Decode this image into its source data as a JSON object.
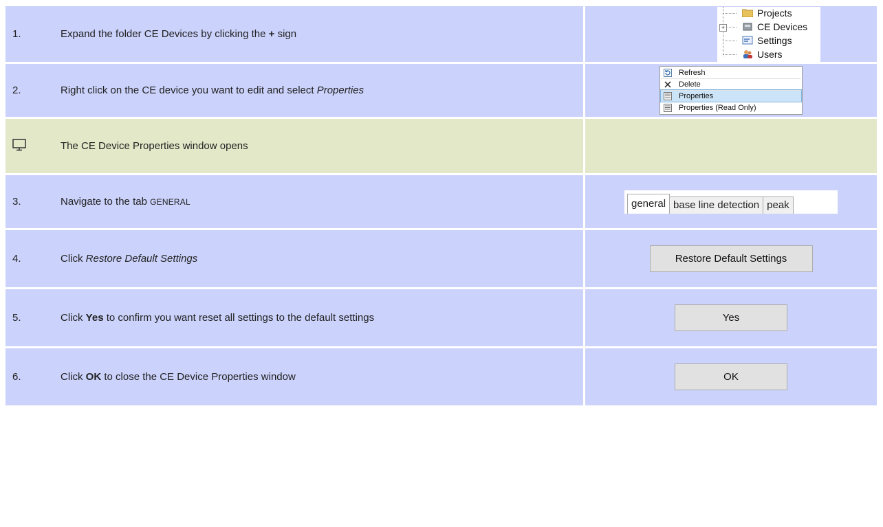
{
  "steps": [
    {
      "num": "1.",
      "pre": "Expand the folder CE Devices by clicking the ",
      "bold": "+",
      "post": " sign"
    },
    {
      "num": "2.",
      "pre": "Right click on the CE device you want to edit and select ",
      "italic": "Properties",
      "post": ""
    },
    {
      "note": "The CE Device Properties window opens"
    },
    {
      "num": "3.",
      "pre": "Navigate to the tab ",
      "smallcaps": "GENERAL",
      "post": ""
    },
    {
      "num": "4.",
      "pre": "Click ",
      "italic": "Restore Default Settings",
      "post": ""
    },
    {
      "num": "5.",
      "pre": "Click ",
      "bold": "Yes",
      "post": " to confirm you want reset all settings to the default settings"
    },
    {
      "num": "6.",
      "pre": "Click ",
      "bold": "OK",
      "post": " to close the CE Device Properties window"
    }
  ],
  "tree": {
    "items": [
      "Projects",
      "CE Devices",
      "Settings",
      "Users"
    ],
    "icons": [
      "folder-icon",
      "ce-device-icon",
      "settings-icon",
      "users-icon"
    ],
    "expander": "+"
  },
  "menu": {
    "items": [
      "Refresh",
      "Delete",
      "Properties",
      "Properties (Read Only)"
    ],
    "icons": [
      "refresh-icon",
      "delete-icon",
      "properties-icon",
      "properties-readonly-icon"
    ],
    "selected": "Properties"
  },
  "tabs": [
    "general",
    "base line detection",
    "peak"
  ],
  "buttons": {
    "restore": "Restore Default Settings",
    "yes": "Yes",
    "ok": "OK"
  },
  "colors": {
    "step_bg": "#cbd2fb",
    "note_bg": "#e3e8c8"
  }
}
